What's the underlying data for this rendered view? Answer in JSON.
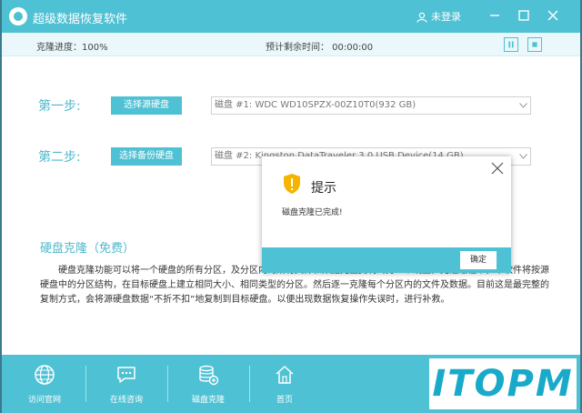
{
  "titlebar": {
    "title": "超级数据恢复软件",
    "user_label": "未登录"
  },
  "status": {
    "progress": "克隆进度：100%",
    "remaining": "预计剩余时间：  00:00:00"
  },
  "steps": [
    {
      "label": "第一步:",
      "button": "选择源硬盘",
      "disk": "磁盘 #1: WDC WD10SPZX-00Z10T0(932 GB)"
    },
    {
      "label": "第二步:",
      "button": "选择备份硬盘",
      "disk": "磁盘 #2: Kingston DataTraveler 3.0 USB Device(14 GB)"
    }
  ],
  "section": {
    "title": "硬盘克隆（免费）",
    "description": "硬盘克隆功能可以将一个硬盘的所有分区，及分区内的所有文件和数据完整复制到另一个硬盘。克隆过程中，本软件将按源硬盘中的分区结构，在目标硬盘上建立相同大小、相同类型的分区。然后逐一克隆每个分区内的文件及数据。目前这是最完整的复制方式，会将源硬盘数据“不折不扣”地复制到目标硬盘。以便出现数据恢复操作失误时，进行补救。"
  },
  "footer": {
    "items": [
      {
        "label": "访问官网",
        "icon": "globe-icon"
      },
      {
        "label": "在线咨询",
        "icon": "chat-icon"
      },
      {
        "label": "磁盘克隆",
        "icon": "disk-clone-icon"
      },
      {
        "label": "首页",
        "icon": "home-icon"
      }
    ]
  },
  "dialog": {
    "title": "提示",
    "message": "磁盘克隆已完成!",
    "ok_label": "确定"
  },
  "watermark": "ITOPM",
  "colors": {
    "accent": "#4fc1d4",
    "step_text": "#4fb8cc",
    "warning": "#f5b400",
    "watermark": "#19a9c9"
  }
}
